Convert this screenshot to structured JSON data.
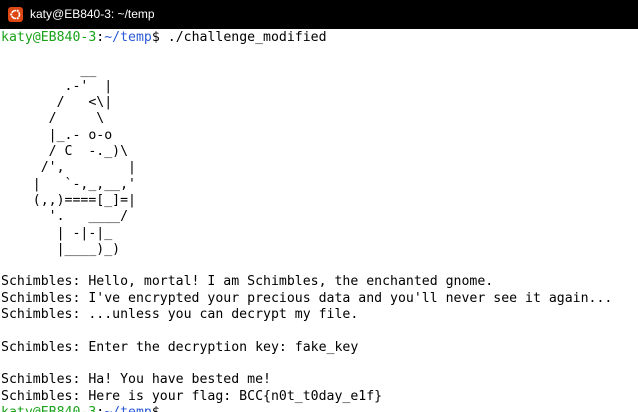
{
  "window": {
    "title": "katy@EB840-3: ~/temp",
    "icon": "ubuntu-logo-icon",
    "icon_color": "#dd4814",
    "titlebar_color": "#000000"
  },
  "terminal": {
    "user_host": "katy@EB840-3",
    "colon": ":",
    "path": "~/temp",
    "prompt_suffix": "$ ",
    "command": "./challenge_modified",
    "colors": {
      "user_host": "#1aa31a",
      "path": "#2b5bd4"
    },
    "ascii_art": [
      "          __",
      "        .-'  |",
      "       /   <\\|",
      "      /     \\",
      "      |_.- o-o",
      "      / C  -._)\\",
      "     /',        |",
      "    |   `-,_,__,'",
      "    (,,)====[_]=|",
      "      '.   ____/",
      "       | -|-|_",
      "       |____)_)"
    ],
    "messages": [
      "Schimbles: Hello, mortal! I am Schimbles, the enchanted gnome.",
      "Schimbles: I've encrypted your precious data and you'll never see it again...",
      "Schimbles: ...unless you can decrypt my file.",
      "",
      "Schimbles: Enter the decryption key: fake_key",
      "",
      "Schimbles: Ha! You have bested me!",
      "Schimbles: Here is your flag: BCC{n0t_t0day_e1f}"
    ]
  }
}
